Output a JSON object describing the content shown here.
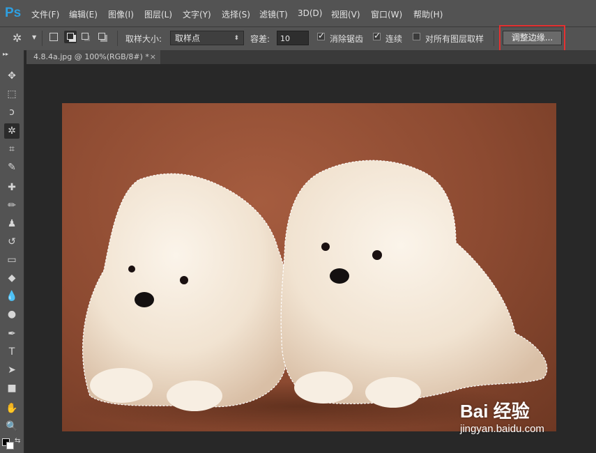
{
  "app": {
    "logo": "Ps"
  },
  "menu": [
    "文件(F)",
    "编辑(E)",
    "图像(I)",
    "图层(L)",
    "文字(Y)",
    "选择(S)",
    "滤镜(T)",
    "3D(D)",
    "视图(V)",
    "窗口(W)",
    "帮助(H)"
  ],
  "options": {
    "sample_size_label": "取样大小:",
    "sample_size_value": "取样点",
    "tolerance_label": "容差:",
    "tolerance_value": "10",
    "antialias_label": "消除锯齿",
    "contiguous_label": "连续",
    "all_layers_label": "对所有图层取样",
    "refine_edge_label": "调整边缘..."
  },
  "document": {
    "tab_title": "4.8.4a.jpg @ 100%(RGB/8#) *",
    "close_glyph": "×"
  },
  "watermark": {
    "brand": "Bai 经验",
    "url": "jingyan.baidu.com"
  },
  "icons": {
    "move": "✥",
    "marquee": "⬚",
    "lasso": "ↄ",
    "magic_wand": "✲",
    "crop": "⌗",
    "eyedropper": "✎",
    "healing": "✚",
    "brush": "✏",
    "stamp": "♟",
    "history_brush": "↺",
    "eraser": "▭",
    "paint_bucket": "◆",
    "blur": "💧",
    "dodge": "●",
    "pen": "✒",
    "type": "T",
    "path_select": "➤",
    "rectangle": "■",
    "hand": "✋",
    "zoom": "🔍"
  },
  "colors": {
    "accent_logo": "#2e9fe0",
    "highlight_box": "#e53030"
  }
}
